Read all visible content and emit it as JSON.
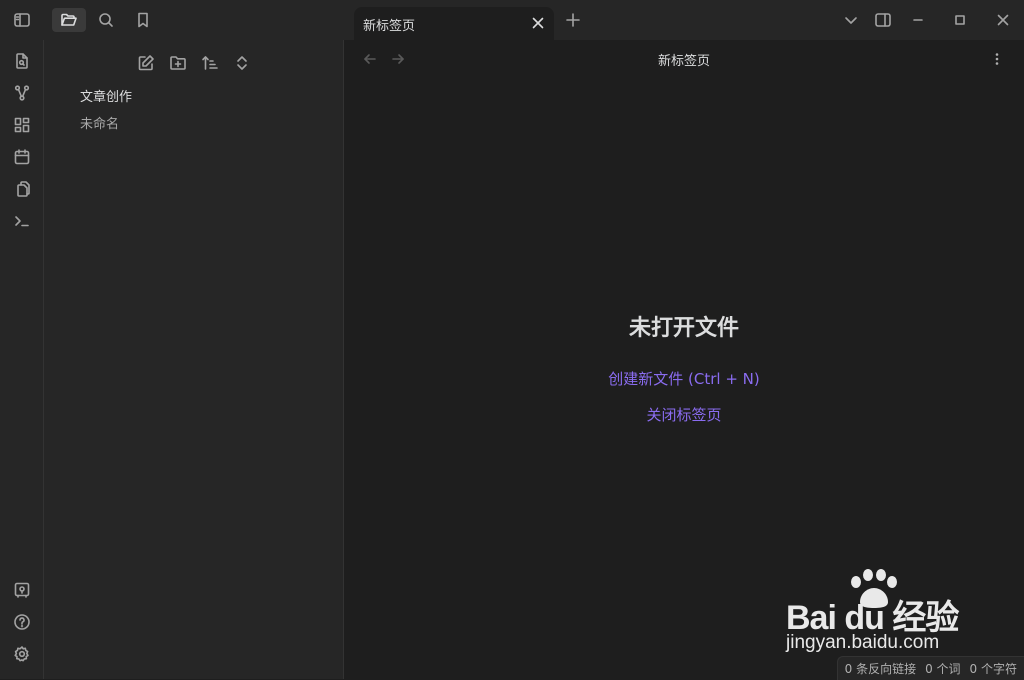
{
  "colors": {
    "accent": "#8a6cf0",
    "background": "#1e1e1e",
    "panel": "#262626"
  },
  "tabs": [
    {
      "label": "新标签页",
      "active": true
    }
  ],
  "explorer": {
    "items": [
      {
        "label": "文章创作",
        "type": "folder"
      },
      {
        "label": "未命名",
        "type": "file"
      }
    ]
  },
  "main": {
    "view_title": "新标签页",
    "empty_title": "未打开文件",
    "create_link": "创建新文件 (Ctrl + N)",
    "close_link": "关闭标签页"
  },
  "status": {
    "backlinks": "0 条反向链接",
    "words": "0 个词",
    "chars": "0 个字符"
  },
  "watermark": {
    "brand": "Bai du 经验",
    "url": "jingyan.baidu.com"
  }
}
